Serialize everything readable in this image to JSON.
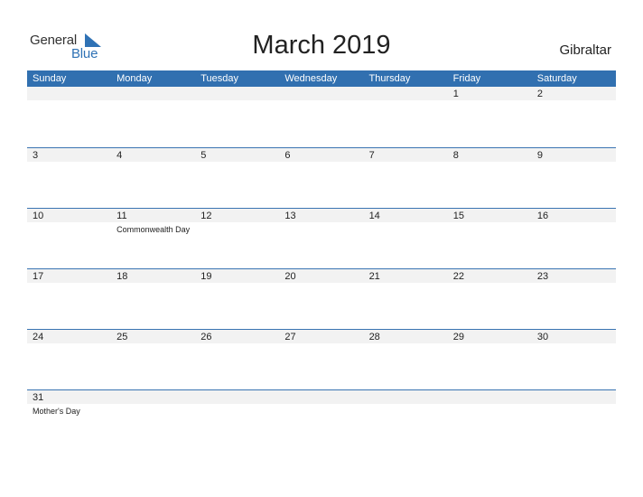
{
  "header": {
    "logo_general": "General",
    "logo_blue": "Blue",
    "title": "March 2019",
    "region": "Gibraltar"
  },
  "weekdays": [
    "Sunday",
    "Monday",
    "Tuesday",
    "Wednesday",
    "Thursday",
    "Friday",
    "Saturday"
  ],
  "weeks": [
    [
      "",
      "",
      "",
      "",
      "",
      "1",
      "2"
    ],
    [
      "3",
      "4",
      "5",
      "6",
      "7",
      "8",
      "9"
    ],
    [
      "10",
      "11",
      "12",
      "13",
      "14",
      "15",
      "16"
    ],
    [
      "17",
      "18",
      "19",
      "20",
      "21",
      "22",
      "23"
    ],
    [
      "24",
      "25",
      "26",
      "27",
      "28",
      "29",
      "30"
    ],
    [
      "31",
      "",
      "",
      "",
      "",
      "",
      ""
    ]
  ],
  "events": {
    "w2d1": "Commonwealth Day",
    "w5d0": "Mother's Day"
  },
  "colors": {
    "accent": "#3170b0",
    "row_band": "#f2f2f2",
    "logo_blue": "#2f72b5"
  }
}
